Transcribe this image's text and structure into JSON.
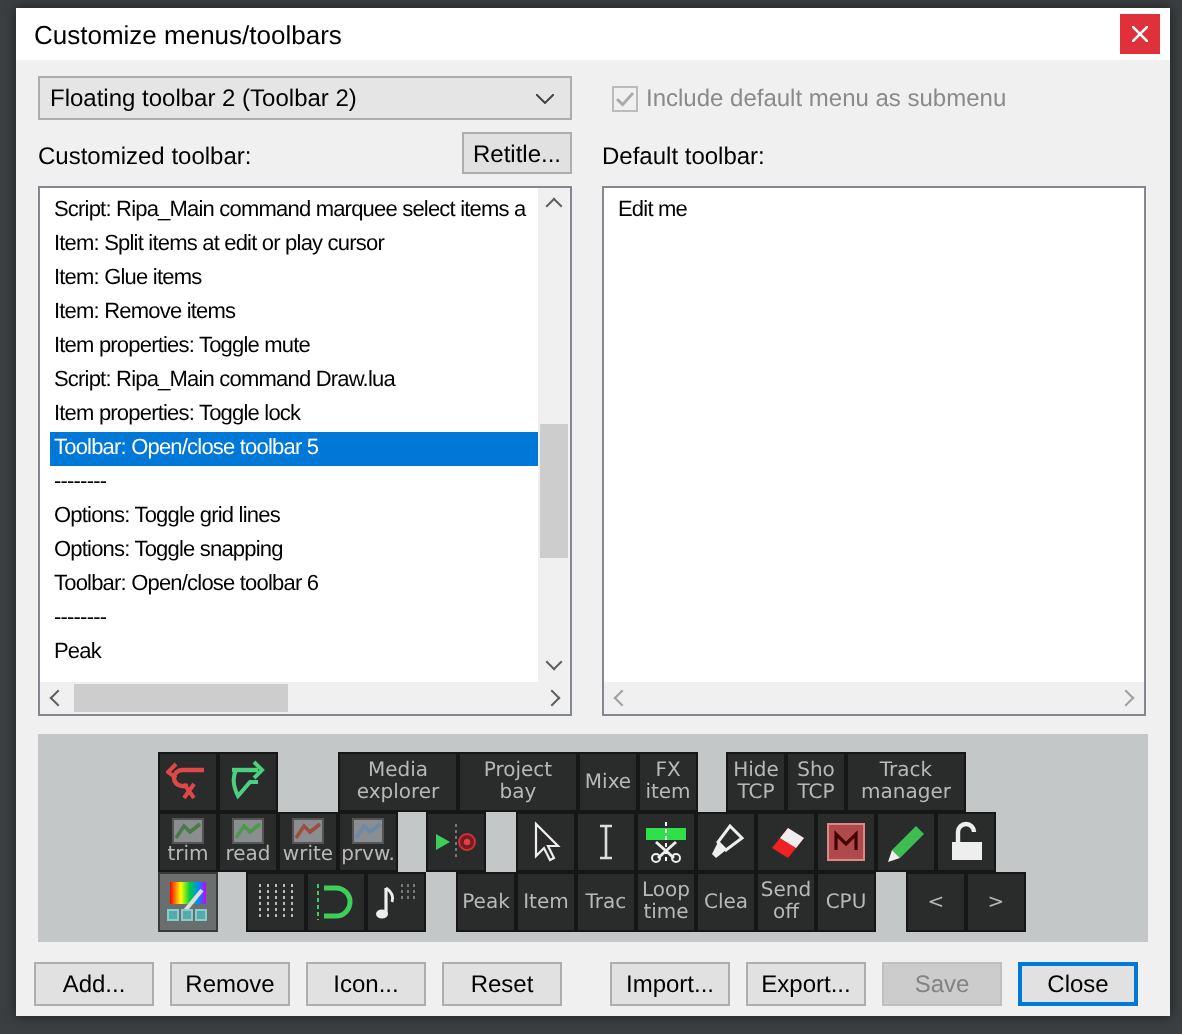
{
  "window": {
    "title": "Customize menus/toolbars"
  },
  "toolbar_select": {
    "value": "Floating toolbar 2 (Toolbar 2)"
  },
  "include_default": {
    "label": "Include default menu as submenu",
    "checked": true,
    "disabled": true
  },
  "customized": {
    "label": "Customized toolbar:",
    "retitle": "Retitle...",
    "items": [
      {
        "text": "Script: Ripa_Main command marquee select items a",
        "selected": false
      },
      {
        "text": "Item: Split items at edit or play cursor",
        "selected": false
      },
      {
        "text": "Item: Glue items",
        "selected": false
      },
      {
        "text": "Item: Remove items",
        "selected": false
      },
      {
        "text": "Item properties: Toggle mute",
        "selected": false
      },
      {
        "text": "Script: Ripa_Main command Draw.lua",
        "selected": false
      },
      {
        "text": "Item properties: Toggle lock",
        "selected": false
      },
      {
        "text": "Toolbar: Open/close toolbar 5",
        "selected": true
      },
      {
        "text": "--------",
        "selected": false
      },
      {
        "text": "Options: Toggle grid lines",
        "selected": false
      },
      {
        "text": "Options: Toggle snapping",
        "selected": false
      },
      {
        "text": "Toolbar: Open/close toolbar 6",
        "selected": false
      },
      {
        "text": "--------",
        "selected": false
      },
      {
        "text": "Peak",
        "selected": false
      }
    ]
  },
  "default": {
    "label": "Default toolbar:",
    "items": [
      {
        "text": "Edit me",
        "selected": false
      }
    ]
  },
  "preview": {
    "buttons": [
      {
        "kind": "icon"
      },
      {
        "kind": "icon"
      },
      {
        "kind": "text",
        "label": "Media\nexplorer"
      },
      {
        "kind": "text",
        "label": "Project\nbay"
      },
      {
        "kind": "text",
        "label": "Mixe"
      },
      {
        "kind": "text",
        "label": "FX\nitem"
      },
      {
        "kind": "text",
        "label": "Hide\nTCP"
      },
      {
        "kind": "text",
        "label": "Sho\nTCP"
      },
      {
        "kind": "text",
        "label": "Track\nmanager"
      },
      {
        "kind": "labeled",
        "label": "trim"
      },
      {
        "kind": "labeled",
        "label": "read"
      },
      {
        "kind": "labeled",
        "label": "write"
      },
      {
        "kind": "labeled",
        "label": "prvw."
      },
      {
        "kind": "icon"
      },
      {
        "kind": "icon"
      },
      {
        "kind": "icon"
      },
      {
        "kind": "icon"
      },
      {
        "kind": "icon"
      },
      {
        "kind": "icon"
      },
      {
        "kind": "icon"
      },
      {
        "kind": "icon"
      },
      {
        "kind": "icon"
      },
      {
        "kind": "icon"
      },
      {
        "kind": "icon"
      },
      {
        "kind": "icon"
      },
      {
        "kind": "icon"
      },
      {
        "kind": "text",
        "label": "Peak"
      },
      {
        "kind": "text",
        "label": "Item"
      },
      {
        "kind": "text",
        "label": "Trac"
      },
      {
        "kind": "text",
        "label": "Loop\ntime"
      },
      {
        "kind": "text",
        "label": "Clea"
      },
      {
        "kind": "text",
        "label": "Send\noff"
      },
      {
        "kind": "text",
        "label": "CPU"
      },
      {
        "kind": "text",
        "label": "<"
      },
      {
        "kind": "text",
        "label": ">"
      }
    ]
  },
  "buttons": [
    {
      "label": "Add...",
      "disabled": false,
      "focused": false
    },
    {
      "label": "Remove",
      "disabled": false,
      "focused": false
    },
    {
      "label": "Icon...",
      "disabled": false,
      "focused": false
    },
    {
      "label": "Reset",
      "disabled": false,
      "focused": false
    },
    {
      "label": "Import...",
      "disabled": false,
      "focused": false
    },
    {
      "label": "Export...",
      "disabled": false,
      "focused": false
    },
    {
      "label": "Save",
      "disabled": true,
      "focused": false
    },
    {
      "label": "Close",
      "disabled": false,
      "focused": true
    }
  ]
}
